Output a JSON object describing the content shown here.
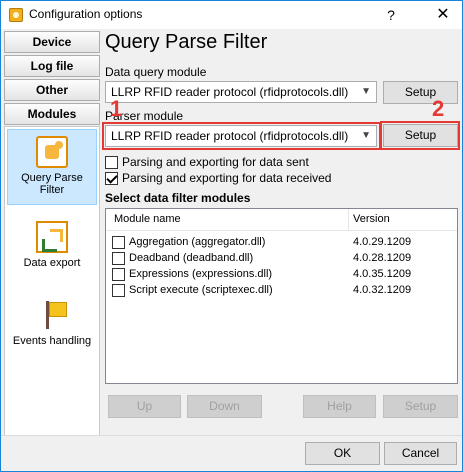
{
  "window": {
    "title": "Configuration options",
    "help_glyph": "?",
    "close_glyph": "✕"
  },
  "nav": {
    "tabs": [
      "Device",
      "Log file",
      "Other",
      "Modules"
    ],
    "items": [
      {
        "label": "Query Parse Filter",
        "icon": "puzzle-icon",
        "selected": true
      },
      {
        "label": "Data export",
        "icon": "export-icon",
        "selected": false
      },
      {
        "label": "Events handling",
        "icon": "flag-icon",
        "selected": false
      }
    ]
  },
  "main": {
    "title": "Query Parse Filter",
    "data_query_module": {
      "label": "Data query module",
      "value": "LLRP RFID reader protocol (rfidprotocols.dll)",
      "setup": "Setup"
    },
    "parser_module": {
      "label": "Parser module",
      "value": "LLRP RFID reader protocol (rfidprotocols.dll)",
      "setup": "Setup"
    },
    "parse_sent": {
      "label": "Parsing and exporting for data sent",
      "checked": false
    },
    "parse_received": {
      "label": "Parsing and exporting for data received",
      "checked": true
    },
    "filter_title": "Select data filter modules",
    "filter_table": {
      "columns": [
        "Module name",
        "Version"
      ],
      "rows": [
        {
          "name": "Aggregation (aggregator.dll)",
          "version": "4.0.29.1209",
          "checked": false
        },
        {
          "name": "Deadband (deadband.dll)",
          "version": "4.0.28.1209",
          "checked": false
        },
        {
          "name": "Expressions (expressions.dll)",
          "version": "4.0.35.1209",
          "checked": false
        },
        {
          "name": "Script execute (scriptexec.dll)",
          "version": "4.0.32.1209",
          "checked": false
        }
      ]
    },
    "buttons": {
      "up": "Up",
      "down": "Down",
      "help": "Help",
      "setup": "Setup"
    }
  },
  "annotations": {
    "one": "1",
    "two": "2"
  },
  "footer": {
    "ok": "OK",
    "cancel": "Cancel"
  },
  "colors": {
    "highlight": "#e53935",
    "selection": "#cce8ff",
    "accent": "#1883d7"
  }
}
